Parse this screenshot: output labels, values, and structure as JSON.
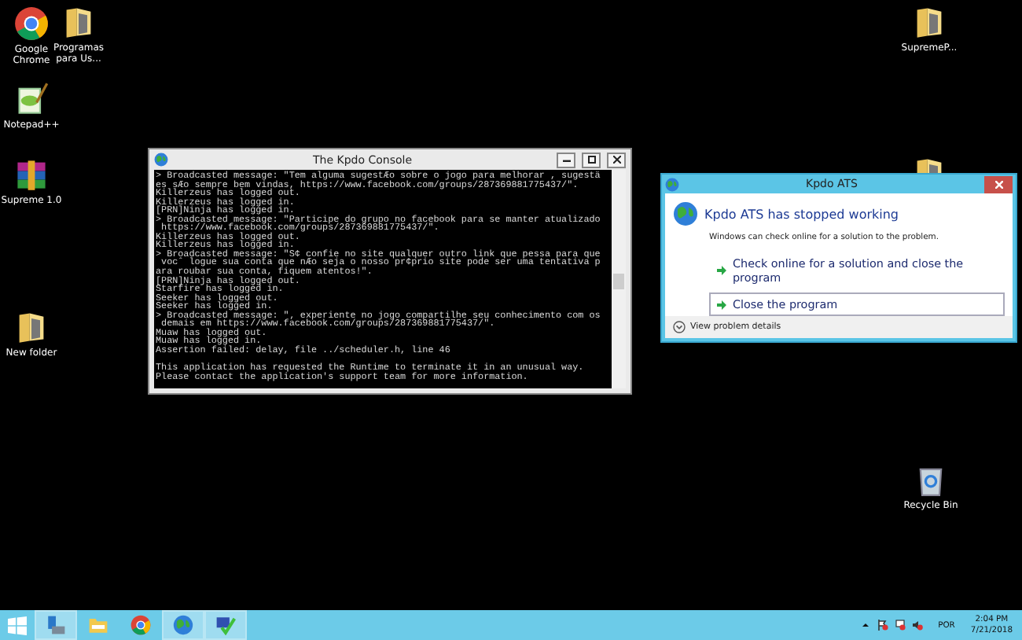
{
  "desktop_icons": [
    {
      "kind": "chrome",
      "label": "Google Chrome"
    },
    {
      "kind": "folder",
      "label": "Programas para Us..."
    },
    {
      "kind": "notepad",
      "label": "Notepad++"
    },
    {
      "kind": "archive",
      "label": "Supreme 1.0"
    },
    {
      "kind": "folder",
      "label": "New folder"
    },
    {
      "kind": "folder",
      "label": "SupremeP..."
    },
    {
      "kind": "folder"
    },
    {
      "kind": "recycle",
      "label": "Recycle Bin"
    }
  ],
  "console": {
    "title": "The Kpdo Console",
    "output_lines": [
      "> Broadcasted message: \"Tem alguma sugestÆo sobre o jogo para melhorar , sugestä",
      "es sÆo sempre bem vindas, https://www.facebook.com/groups/287369881775437/\".",
      "Killerzeus has logged out.",
      "Killerzeus has logged in.",
      "[PRN]Ninja has logged in.",
      "> Broadcasted message: \"Participe do grupo no facebook para se manter atualizado",
      " https://www.facebook.com/groups/287369881775437/\".",
      "Killerzeus has logged out.",
      "Killerzeus has logged in.",
      "> Broadcasted message: \"S¢ confie no site qualquer outro link que pessa para que",
      " vocˆ logue sua conta que nÆo seja o nosso pr¢prio site pode ser uma tentativa p",
      "ara roubar sua conta, fiquem atentos!\".",
      "[PRN]Ninja has logged out.",
      "Starfire has logged in.",
      "Seeker has logged out.",
      "Seeker has logged in.",
      "> Broadcasted message: \"‚ experiente no jogo compartilhe seu conhecimento com os",
      " demais em https://www.facebook.com/groups/287369881775437/\".",
      "Muaw has logged out.",
      "Muaw has logged in.",
      "Assertion failed: delay, file ../scheduler.h, line 46"
    ],
    "error_lines": [
      "This application has requested the Runtime to terminate it in an unusual way.",
      "Please contact the application's support team for more information."
    ]
  },
  "dialog": {
    "title": "Kpdo ATS",
    "heading": "Kpdo ATS has stopped working",
    "message": "Windows can check online for a solution to the problem.",
    "options": [
      {
        "label": "Check online for a solution and close the program",
        "selected": false
      },
      {
        "label": "Close the program",
        "selected": true
      }
    ],
    "details_link": "View problem details"
  },
  "taskbar": {
    "apps": [
      {
        "kind": "server",
        "active": true
      },
      {
        "kind": "explorer",
        "active": false
      },
      {
        "kind": "chrome",
        "active": false
      },
      {
        "kind": "globe",
        "active": true
      },
      {
        "kind": "check",
        "active": true
      }
    ],
    "language": "POR",
    "time": "2:04 PM",
    "date": "7/21/2018"
  }
}
